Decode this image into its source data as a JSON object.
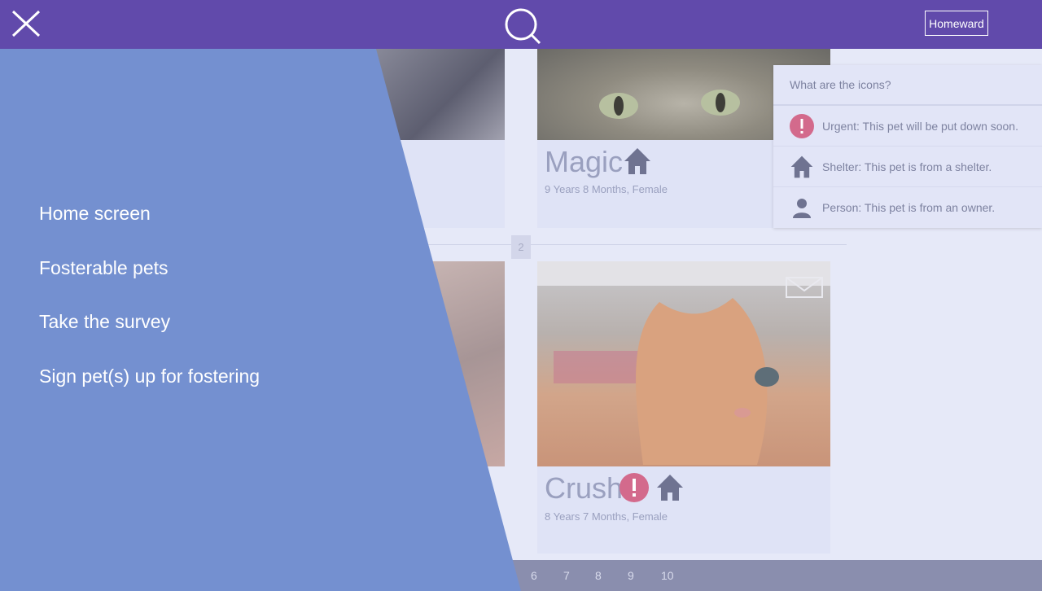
{
  "header": {
    "brand": "Homeward",
    "close_icon": "close-icon",
    "search_icon": "search-icon",
    "bar_color": "#614aab"
  },
  "drawer": {
    "color": "#7490d0",
    "items": [
      {
        "label": "Home screen"
      },
      {
        "label": "Fosterable pets"
      },
      {
        "label": "Take the survey"
      },
      {
        "label": "Sign pet(s) up for fostering"
      }
    ]
  },
  "pets": [
    {
      "name": "Magic",
      "meta": "9 Years 8 Months, Female",
      "icons": [
        "shelter-icon"
      ]
    },
    {
      "name": "Crush",
      "meta": "8 Years 7 Months, Female",
      "icons": [
        "urgent-icon",
        "shelter-icon"
      ]
    }
  ],
  "separator_page": "2",
  "legend": {
    "title": "What are the icons?",
    "rows": [
      {
        "icon": "urgent-icon",
        "text": "Urgent: This pet will be put down soon."
      },
      {
        "icon": "shelter-icon",
        "text": "Shelter: This pet is from a shelter."
      },
      {
        "icon": "person-icon",
        "text": "Person: This pet is from an owner."
      }
    ]
  },
  "pagination": [
    "6",
    "7",
    "8",
    "9",
    "10"
  ],
  "colors": {
    "urgent": "#d36a8c",
    "icon_dark": "#6f7391"
  }
}
